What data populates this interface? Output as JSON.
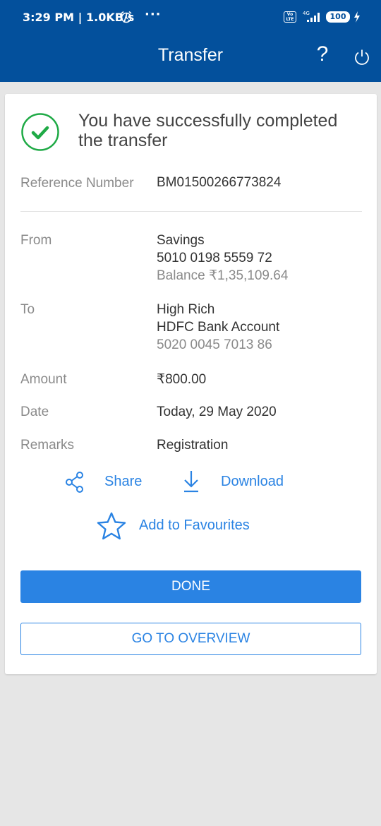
{
  "status_bar": {
    "time": "3:29 PM | 1.0KB/s",
    "more": "···",
    "volte": "Vo LTE",
    "network": "4G",
    "battery": "100"
  },
  "header": {
    "title": "Transfer",
    "help": "?"
  },
  "confirmation": {
    "message": "You have successfully completed the transfer",
    "reference_label": "Reference Number",
    "reference_value": "BM01500266773824"
  },
  "details": {
    "from_label": "From",
    "from_account_type": "Savings",
    "from_account_number": "5010 0198 5559 72",
    "from_balance": "Balance ₹1,35,109.64",
    "to_label": "To",
    "to_name": "High Rich",
    "to_bank": "HDFC Bank Account",
    "to_account_number": "5020 0045 7013 86",
    "amount_label": "Amount",
    "amount_value": "₹800.00",
    "date_label": "Date",
    "date_value": "Today, 29 May 2020",
    "remarks_label": "Remarks",
    "remarks_value": "Registration"
  },
  "actions": {
    "share": "Share",
    "download": "Download",
    "favourites": "Add to Favourites",
    "done": "DONE",
    "overview": "GO TO OVERVIEW"
  },
  "colors": {
    "header_bg": "#03509c",
    "accent": "#2a83e3",
    "success": "#1faa46"
  }
}
